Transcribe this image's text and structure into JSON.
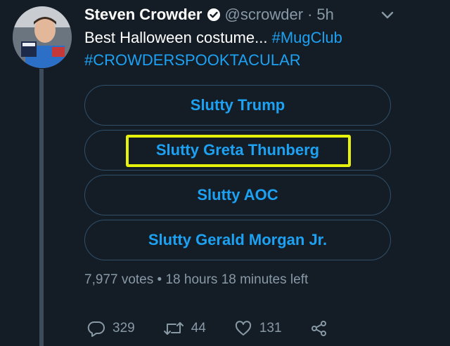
{
  "tweet": {
    "author_name": "Steven Crowder",
    "handle": "@scrowder",
    "separator": "·",
    "time": "5h",
    "text_plain": "Best Halloween costume... ",
    "hashtag_1": "#MugClub",
    "hashtag_2": "#CROWDERSPOOKTACULAR"
  },
  "poll": {
    "options": [
      {
        "label": "Slutty Trump"
      },
      {
        "label": "Slutty Greta Thunberg"
      },
      {
        "label": "Slutty AOC"
      },
      {
        "label": "Slutty Gerald Morgan Jr."
      }
    ],
    "votes": "7,977 votes",
    "meta_separator": "•",
    "time_left": "18 hours 18 minutes left"
  },
  "actions": {
    "replies": "329",
    "retweets": "44",
    "likes": "131"
  },
  "colors": {
    "background": "#141d26",
    "accent": "#1da1f2",
    "muted": "#8899a6",
    "highlight": "#e6f20a"
  }
}
